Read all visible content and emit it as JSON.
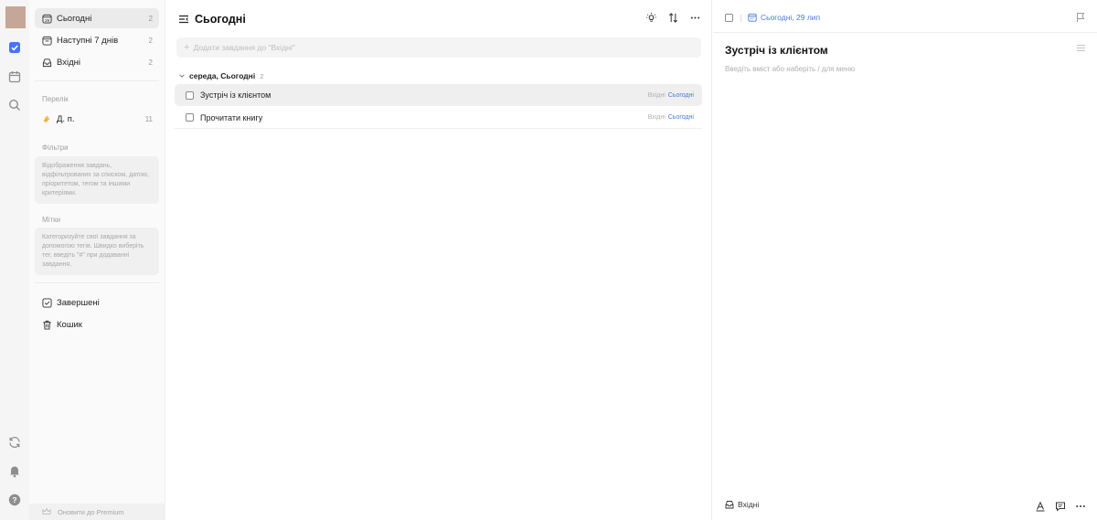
{
  "sidebar": {
    "items": [
      {
        "label": "Сьогодні",
        "count": "2",
        "icon": "calendar-today-icon",
        "active": true
      },
      {
        "label": "Наступні 7 днів",
        "count": "2",
        "icon": "calendar-week-icon"
      },
      {
        "label": "Вхідні",
        "count": "2",
        "icon": "inbox-icon"
      }
    ],
    "lists_header": "Перелік",
    "lists": [
      {
        "label": "Д. п.",
        "count": "11",
        "icon": "hand-emoji-icon"
      }
    ],
    "filters_header": "Фільтри",
    "filters_hint": "Відображення завдань, відфільтрованих за списком, датою, пріоритетом, тегом та іншими критеріями.",
    "tags_header": "Мітки",
    "tags_hint": "Категоризуйте свої завдання за допомогою тегів. Швидко виберіть тег, введіть \"#\" при додаванні завдання.",
    "completed": "Завершені",
    "trash": "Кошик",
    "premium": "Оновити до Premium"
  },
  "main": {
    "title": "Сьогодні",
    "add_placeholder": "Додати завдання до \"Вхідні\"",
    "group_label": "середа, Сьогодні",
    "group_count": "2",
    "tasks": [
      {
        "title": "Зустріч із клієнтом",
        "list": "Вхідні",
        "date": "Сьогодні",
        "selected": true
      },
      {
        "title": "Прочитати книгу",
        "list": "Вхідні",
        "date": "Сьогодні",
        "selected": false
      }
    ]
  },
  "detail": {
    "date": "Сьогодні, 29 лип",
    "title": "Зустріч із клієнтом",
    "placeholder": "Введіть вміст або наберіть / для меню",
    "list": "Вхідні"
  },
  "colors": {
    "accent": "#4a7bd9",
    "rail_check": "#4772fa",
    "avatar": "#c6a797"
  }
}
